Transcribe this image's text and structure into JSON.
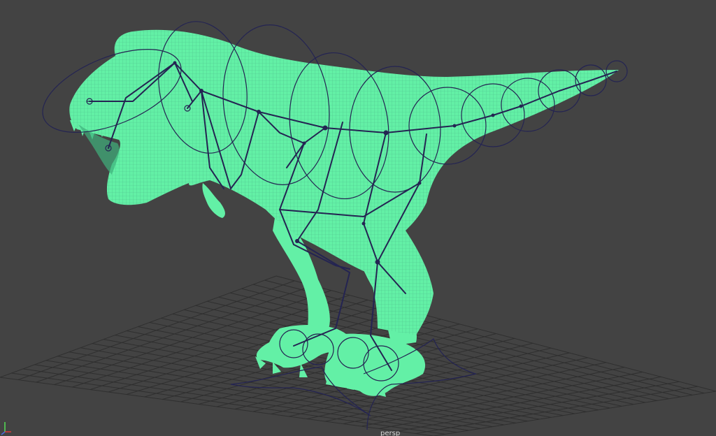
{
  "viewport": {
    "camera_name": "persp",
    "background_color": "#434343",
    "grid_color": "#2f2f2f",
    "mesh_color": "#63f0a6",
    "wire_color": "#3d9a78",
    "rig_color": "#242452"
  },
  "scene": {
    "model": "tyrannosaurus",
    "display_mode": "wireframe-on-shaded",
    "rig": "skeleton-with-joint-controls"
  },
  "axis_gizmo": {
    "x_color": "#d83a3a",
    "y_color": "#55e055",
    "z_color": "#4a6adc"
  }
}
